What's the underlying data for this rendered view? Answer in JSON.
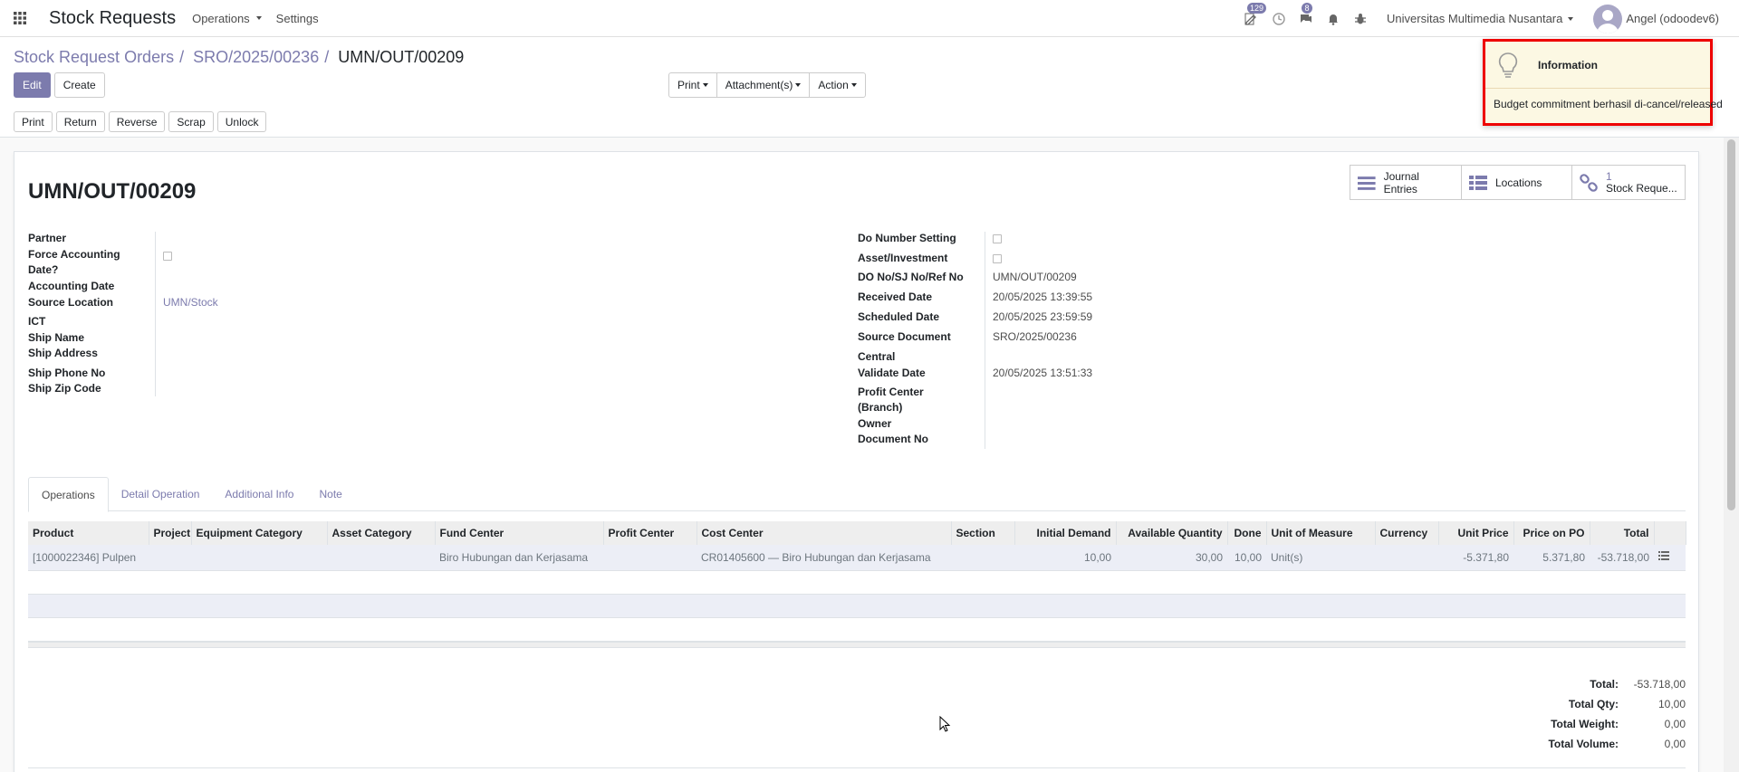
{
  "navbar": {
    "app_title": "Stock Requests",
    "menus": [
      "Operations",
      "Settings"
    ],
    "badges": {
      "activity": "129",
      "messages": "8"
    },
    "company": "Universitas Multimedia Nusantara",
    "user": "Angel (odoodev6)"
  },
  "breadcrumb": {
    "items": [
      "Stock Request Orders",
      "SRO/2025/00236"
    ],
    "current": "UMN/OUT/00209"
  },
  "control_panel": {
    "edit": "Edit",
    "create": "Create",
    "sidebar": [
      "Print",
      "Attachment(s)",
      "Action"
    ]
  },
  "statusbar": {
    "buttons": [
      "Print",
      "Return",
      "Reverse",
      "Scrap",
      "Unlock"
    ]
  },
  "smart_buttons": {
    "journal": "Journal Entries",
    "locations": "Locations",
    "stock_count": "1",
    "stock_label": "Stock Reque..."
  },
  "record": {
    "title": "UMN/OUT/00209"
  },
  "left_fields": {
    "partner": "Partner",
    "force_accounting_line1": "Force Accounting",
    "force_accounting_line2": "Date?",
    "accounting_date": "Accounting Date",
    "source_location": "Source Location",
    "source_location_value": "UMN/Stock",
    "ict": "ICT",
    "ship_name": "Ship Name",
    "ship_address": "Ship Address",
    "ship_phone": "Ship Phone No",
    "ship_zip": "Ship Zip Code"
  },
  "right_fields": {
    "do_number_setting": "Do Number Setting",
    "asset_investment": "Asset/Investment",
    "do_no": "DO No/SJ No/Ref No",
    "do_no_value": "UMN/OUT/00209",
    "received_date": "Received Date",
    "received_date_value": "20/05/2025 13:39:55",
    "scheduled_date": "Scheduled Date",
    "scheduled_date_value": "20/05/2025 23:59:59",
    "source_document": "Source Document",
    "source_document_value": "SRO/2025/00236",
    "central": "Central",
    "validate_date": "Validate Date",
    "validate_date_value": "20/05/2025 13:51:33",
    "profit_center_line1": "Profit Center",
    "profit_center_line2": "(Branch)",
    "owner": "Owner",
    "document_no": "Document No"
  },
  "tabs": [
    "Operations",
    "Detail Operation",
    "Additional Info",
    "Note"
  ],
  "table": {
    "headers": [
      "Product",
      "Project",
      "Equipment Category",
      "Asset Category",
      "Fund Center",
      "Profit Center",
      "Cost Center",
      "Section",
      "Initial Demand",
      "Available Quantity",
      "Done",
      "Unit of Measure",
      "Currency",
      "Unit Price",
      "Price on PO",
      "Total"
    ],
    "row": {
      "product": "[1000022346] Pulpen",
      "project": "",
      "equipment_category": "",
      "asset_category": "",
      "fund_center": "Biro Hubungan dan Kerjasama",
      "profit_center": "",
      "cost_center": "CR01405600 — Biro Hubungan dan Kerjasama",
      "section": "",
      "initial_demand": "10,00",
      "available_quantity": "30,00",
      "done": "10,00",
      "uom": "Unit(s)",
      "currency": "",
      "unit_price": "-5.371,80",
      "price_on_po": "5.371,80",
      "total": "-53.718,00"
    }
  },
  "totals": {
    "total_label": "Total:",
    "total_value": "-53.718,00",
    "qty_label": "Total Qty:",
    "qty_value": "10,00",
    "weight_label": "Total Weight:",
    "weight_value": "0,00",
    "volume_label": "Total Volume:",
    "volume_value": "0,00"
  },
  "notification": {
    "title": "Information",
    "message": "Budget commitment berhasil di-cancel/released"
  }
}
